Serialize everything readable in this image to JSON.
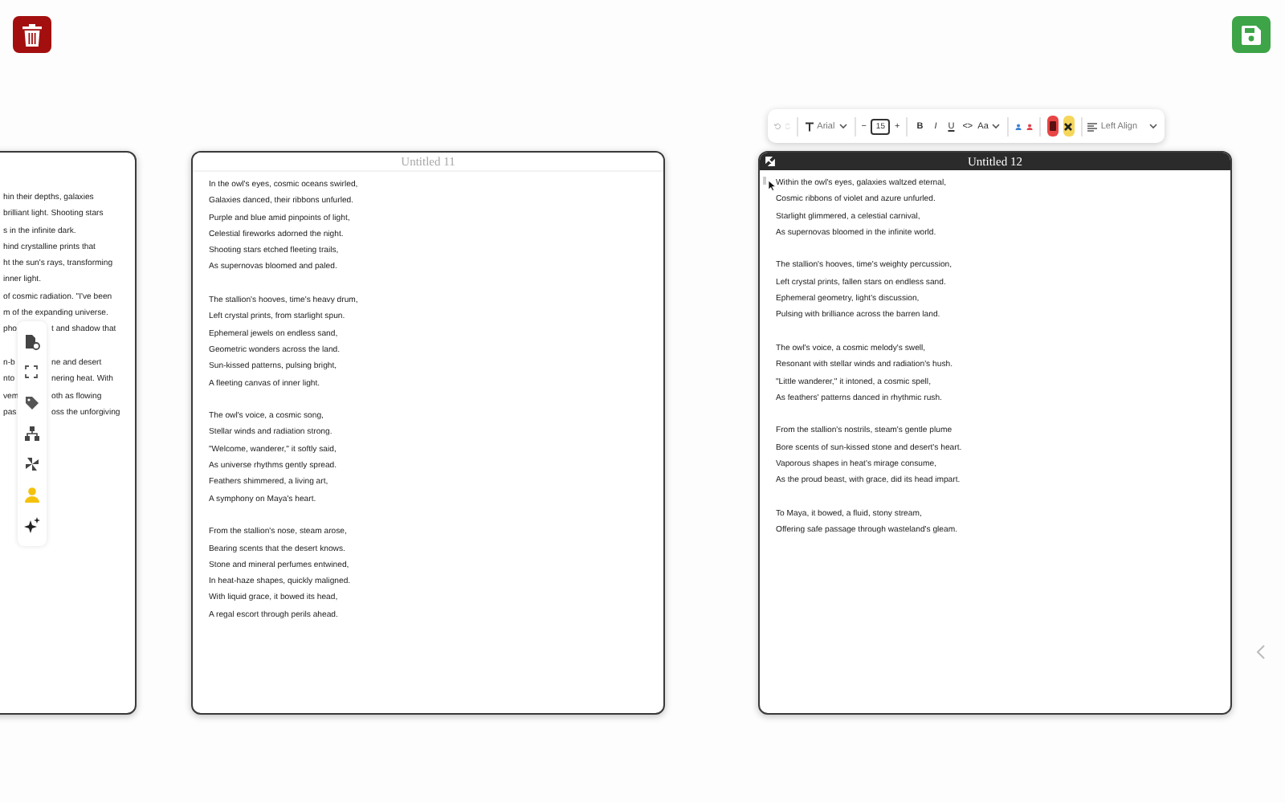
{
  "left_document": {
    "stanzas": [
      [
        {
          "text": "hin their depths, galaxies"
        },
        {
          "text": "brilliant light. Shooting stars"
        },
        {
          "text": "s in the infinite dark."
        },
        {
          "text": "hind crystalline prints that"
        },
        {
          "text": "ht the sun's rays, transforming"
        },
        {
          "text": "inner light."
        },
        {
          "text": "of cosmic radiation. \"I've been"
        },
        {
          "text": "m of the expanding universe."
        },
        {
          "text": "pho",
          "after": "t and shadow that"
        }
      ],
      [
        {
          "text": "n-b",
          "after": "ne and desert"
        },
        {
          "text": "nto",
          "after": "nering heat. With"
        },
        {
          "text": "vem",
          "after": "oth as flowing"
        },
        {
          "text": "pas",
          "after": "oss the unforgiving"
        }
      ]
    ]
  },
  "middle_document": {
    "title": "Untitled 11",
    "active": false,
    "stanzas": [
      [
        {
          "text": "In the owl's eyes, cosmic oceans swirled,"
        },
        {
          "text": "Galaxies danced, their ribbons unfurled."
        },
        {
          "text": "Purple and blue amid pinpoints of light,"
        },
        {
          "text": "Celestial fireworks adorned the night."
        },
        {
          "text": "Shooting stars etched fleeting trails,"
        },
        {
          "text": "As supernovas bloomed and paled."
        }
      ],
      [
        {
          "text": "The stallion's hooves, time's heavy drum,"
        },
        {
          "text": "Left crystal prints, from starlight spun."
        },
        {
          "text": "Ephemeral jewels on endless sand,"
        },
        {
          "text": "Geometric wonders across the land."
        },
        {
          "text": "Sun-kissed patterns, pulsing bright,"
        },
        {
          "text": "A fleeting canvas of inner light."
        }
      ],
      [
        {
          "text": "The owl's voice, a cosmic song,"
        },
        {
          "text": "Stellar winds and radiation strong."
        },
        {
          "text": "\"Welcome, wanderer,\" it softly said,"
        },
        {
          "text": "As universe rhythms gently spread."
        },
        {
          "text": "Feathers shimmered, a living art,"
        },
        {
          "text": "A symphony on Maya's heart."
        }
      ],
      [
        {
          "text": "From the stallion's nose, steam arose,"
        },
        {
          "text": "Bearing scents that the desert knows."
        },
        {
          "text": "Stone and mineral perfumes entwined,"
        },
        {
          "text": "In heat-haze shapes, quickly maligned."
        },
        {
          "text": "With liquid grace, it bowed its head,"
        },
        {
          "text": "A regal escort through perils ahead."
        }
      ]
    ]
  },
  "right_document": {
    "title": "Untitled 12",
    "active": true,
    "stanzas": [
      [
        {
          "text": "Within the owl's eyes, galaxies waltzed eternal,"
        },
        {
          "text": "Cosmic ribbons of violet and azure unfurled."
        },
        {
          "text": "Starlight glimmered, a celestial carnival,"
        },
        {
          "text": "As supernovas bloomed in the infinite world."
        }
      ],
      [
        {
          "text": "The stallion's hooves, time's weighty percussion,"
        },
        {
          "text": "Left crystal prints, fallen stars on endless sand."
        },
        {
          "text": "Ephemeral geometry, light's discussion,"
        },
        {
          "text": "Pulsing with brilliance across the barren land."
        }
      ],
      [
        {
          "text": "The owl's voice, a cosmic melody's swell,"
        },
        {
          "text": "Resonant with stellar winds and radiation's hush."
        },
        {
          "text": "\"Little wanderer,\" it intoned, a cosmic spell,"
        },
        {
          "text": "As feathers' patterns danced in rhythmic rush."
        }
      ],
      [
        {
          "text": "From the stallion's nostrils, steam's gentle plume"
        },
        {
          "text": "Bore scents of sun-kissed stone and desert's heart."
        },
        {
          "text": "Vaporous shapes in heat's mirage consume,"
        },
        {
          "text": "As the proud beast, with grace, did its head impart."
        }
      ],
      [
        {
          "text": "To Maya, it bowed, a fluid, stony stream,"
        },
        {
          "text": "Offering safe passage through wasteland's gleam."
        }
      ]
    ]
  },
  "format_toolbar": {
    "font": "Arial",
    "decrease": "−",
    "font_size": "15",
    "increase": "+",
    "bold": "B",
    "italic": "I",
    "underline": "U",
    "code": "<>",
    "text_case": "Aa",
    "align": "Left Align"
  }
}
